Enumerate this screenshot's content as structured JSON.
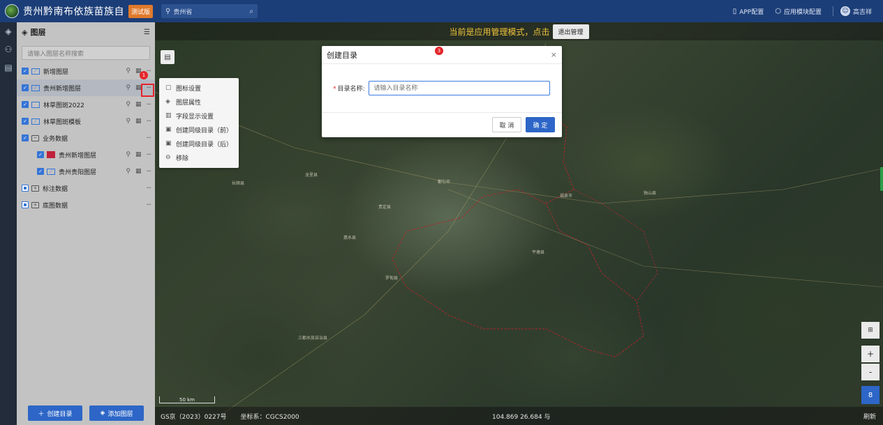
{
  "header": {
    "app_title": "贵州黔南布依族苗族自",
    "badge": "测试版",
    "region_value": "贵州省",
    "app_config": "APP配置",
    "module_config": "应用模块配置",
    "user_name": "高吉祥",
    "colors": {
      "header_bg": "#1c3e78",
      "badge": "#e07a2c"
    }
  },
  "rail": {
    "icons": [
      "layers-icon",
      "people-icon",
      "table-icon"
    ]
  },
  "layer_panel": {
    "title": "图层",
    "search_placeholder": "请输入图层名称搜索",
    "items": [
      {
        "label": "新增图层",
        "type": "layer",
        "checked": true
      },
      {
        "label": "贵州新增图层",
        "type": "layer",
        "checked": true,
        "selected": true
      },
      {
        "label": "林草图斑2022",
        "type": "layer",
        "checked": true
      },
      {
        "label": "林草图斑模板",
        "type": "layer",
        "checked": true
      },
      {
        "label": "业务数据",
        "type": "folder",
        "checked": true
      },
      {
        "label": "贵州新增图层",
        "type": "layer-child",
        "checked": true
      },
      {
        "label": "贵州贵阳图层",
        "type": "layer-child",
        "checked": true
      },
      {
        "label": "标注数据",
        "type": "folder",
        "checked": "partial"
      },
      {
        "label": "底图数据",
        "type": "folder",
        "checked": "partial"
      }
    ],
    "create_dir_button": "创建目录",
    "add_layer_button": "添加图层"
  },
  "context_menu": {
    "items": [
      "图标设置",
      "图层属性",
      "字段显示设置",
      "创建同级目录（前）",
      "创建同级目录（后）",
      "移除"
    ]
  },
  "markers": {
    "one": "1",
    "two": "2",
    "three": "3"
  },
  "map": {
    "notice": "当前是应用管理模式，点击",
    "exit_button": "退出管理",
    "scale_label": "50 km",
    "copyright": "GS京（2023）0227号",
    "crs": "坐标系：CGCS2000",
    "coordinates": "104.869 26.684 与",
    "refresh": "刷新",
    "zoom_in": "+",
    "zoom_out": "-",
    "zoom_level": "8",
    "towns": [
      "都匀市",
      "贵定县",
      "福泉市",
      "龙里县",
      "长顺县",
      "惠水县",
      "罗甸县",
      "平塘县",
      "独山县",
      "三都水族自治县"
    ]
  },
  "dialog": {
    "title": "创建目录",
    "field_label": "目录名称:",
    "required_mark": "*",
    "input_placeholder": "请输入目录名称",
    "input_value": "",
    "cancel_button": "取 消",
    "ok_button": "确 定"
  }
}
